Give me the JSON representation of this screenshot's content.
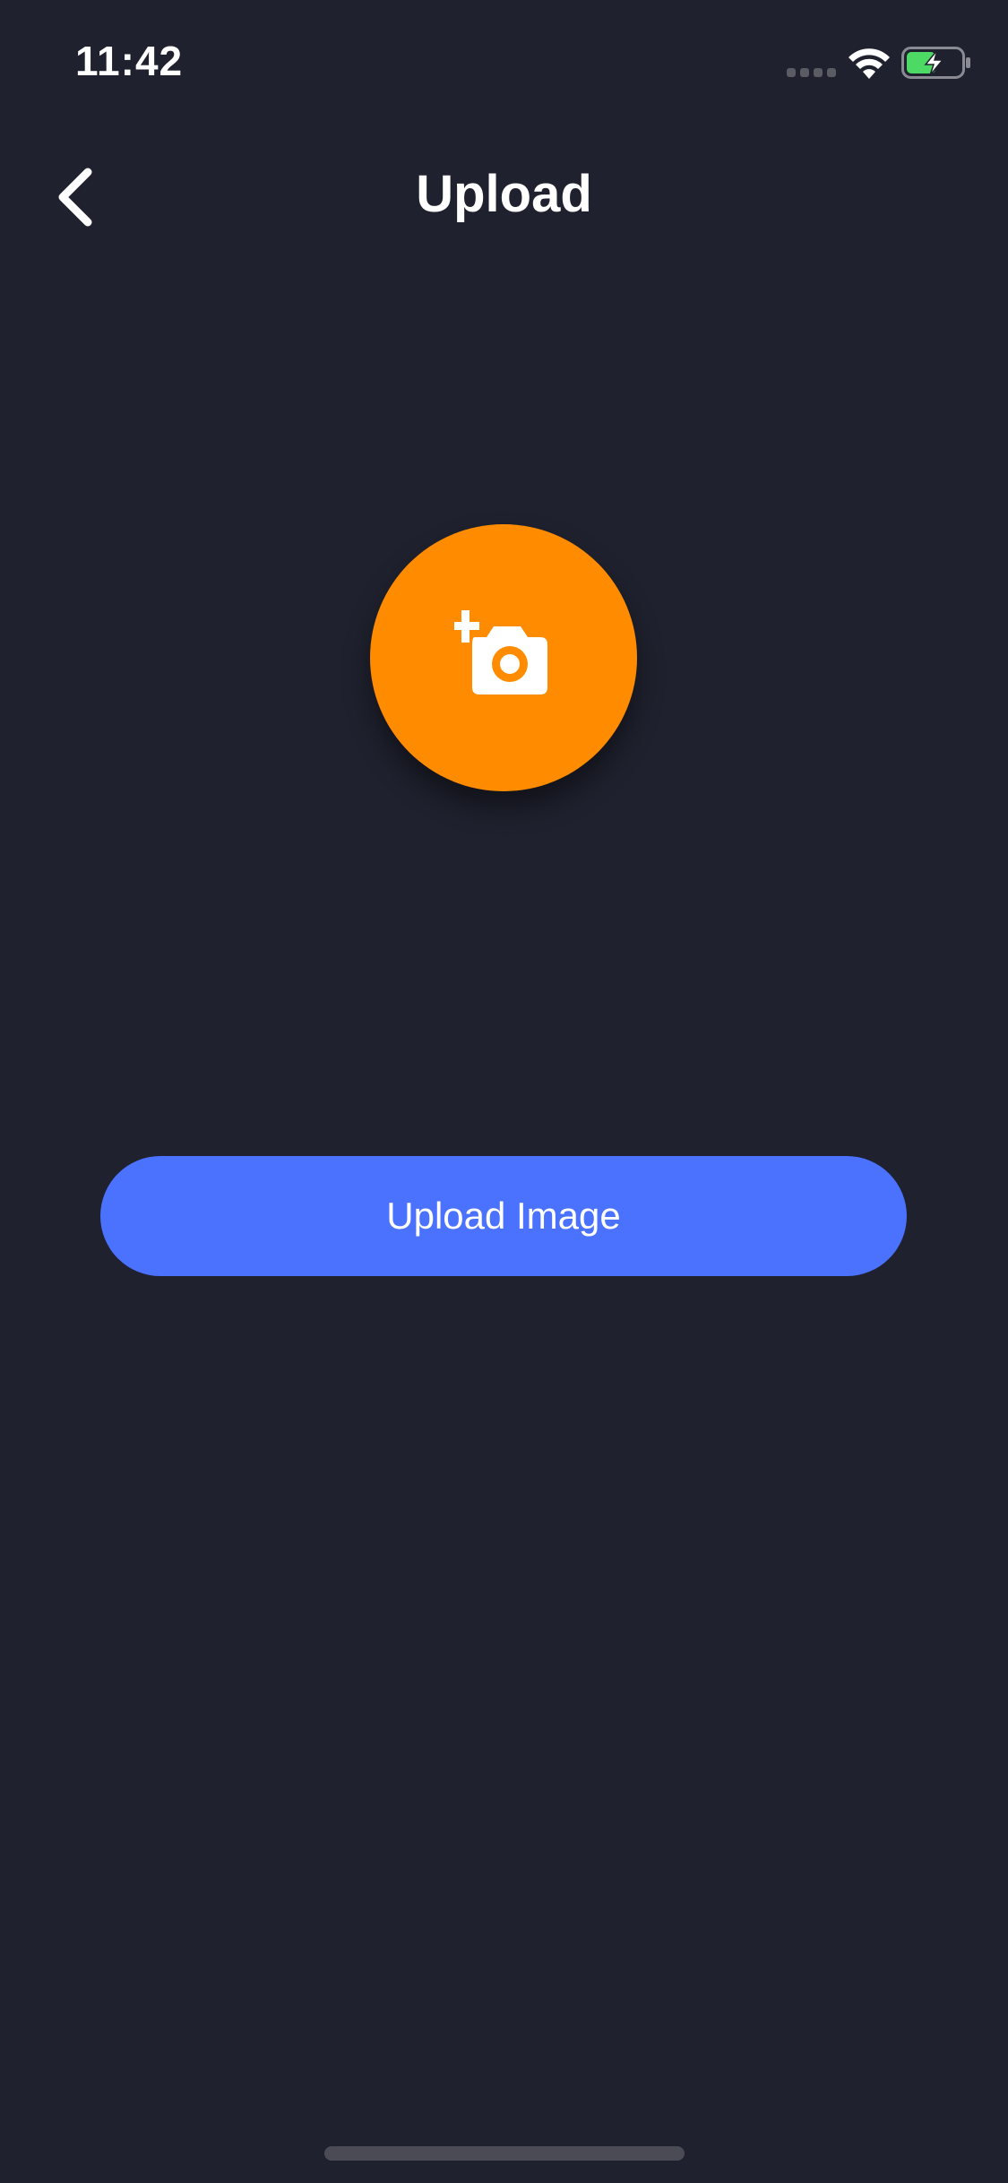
{
  "status_bar": {
    "time": "11:42",
    "icons": [
      "signal-dots-icon",
      "wifi-icon",
      "battery-charging-icon"
    ],
    "battery_color": "#4cd964"
  },
  "nav": {
    "back_icon": "chevron-left-icon",
    "title": "Upload"
  },
  "upload_area": {
    "icon": "add-photo-camera-icon",
    "accent_color": "#ff8c00"
  },
  "actions": {
    "upload_image_label": "Upload Image",
    "button_color": "#4a72ff"
  },
  "colors": {
    "background": "#1f212e",
    "home_indicator": "#4a4b55"
  }
}
